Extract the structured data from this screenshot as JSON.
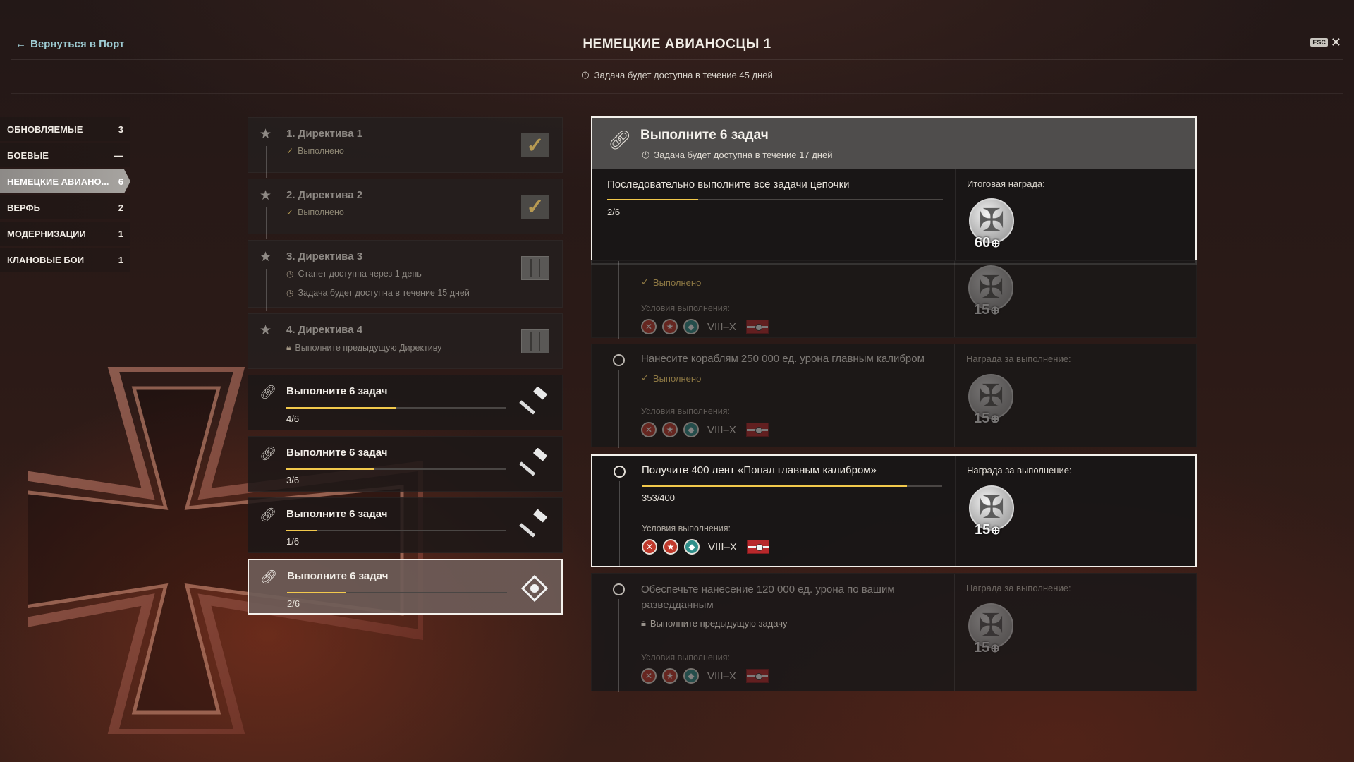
{
  "header": {
    "back_label": "Вернуться в Порт",
    "title": "НЕМЕЦКИЕ АВИАНОСЦЫ 1",
    "availability": "Задача будет доступна в течение 45 дней",
    "esc_label": "ESC",
    "close_icon": "close-icon"
  },
  "categories": [
    {
      "label": "ОБНОВЛЯЕМЫЕ",
      "count": "3",
      "active": false
    },
    {
      "label": "БОЕВЫЕ",
      "count": "—",
      "active": false
    },
    {
      "label": "НЕМЕЦКИЕ АВИАНО...",
      "count": "6",
      "active": true
    },
    {
      "label": "ВЕРФЬ",
      "count": "2",
      "active": false
    },
    {
      "label": "МОДЕРНИЗАЦИИ",
      "count": "1",
      "active": false
    },
    {
      "label": "КЛАНОВЫЕ БОИ",
      "count": "1",
      "active": false
    }
  ],
  "directives": [
    {
      "title": "1. Директива 1",
      "status": "Выполнено"
    },
    {
      "title": "2. Директива 2",
      "status": "Выполнено"
    },
    {
      "title": "3. Директива 3",
      "line1": "Станет доступна через 1 день",
      "line2": "Задача будет доступна в течение 15 дней"
    },
    {
      "title": "4. Директива 4",
      "line1": "Выполните предыдущую Директиву"
    }
  ],
  "chains": [
    {
      "title": "Выполните 6 задач",
      "progress": "4/6",
      "fraction": 0.5
    },
    {
      "title": "Выполните 6 задач",
      "progress": "3/6",
      "fraction": 0.4
    },
    {
      "title": "Выполните 6 задач",
      "progress": "1/6",
      "fraction": 0.14
    },
    {
      "title": "Выполните 6 задач",
      "progress": "2/6",
      "fraction": 0.27
    }
  ],
  "detail": {
    "title": "Выполните 6 задач",
    "availability": "Задача будет доступна в течение 17 дней",
    "description": "Последовательно выполните все задачи цепочки",
    "progress": "2/6",
    "fraction": 0.27,
    "reward_label": "Итоговая награда:",
    "reward_value": "60"
  },
  "tasks": [
    {
      "status": "Выполнено",
      "cond_label": "Условия выполнения:",
      "tier": "VIII–X",
      "reward": "15"
    },
    {
      "title": "Нанесите кораблям 250 000 ед. урона главным калибром",
      "status": "Выполнено",
      "reward_label": "Награда за выполнение:",
      "cond_label": "Условия выполнения:",
      "tier": "VIII–X",
      "reward": "15"
    },
    {
      "title": "Получите 400 лент «Попал главным калибром»",
      "progress": "353/400",
      "fraction": 0.8825,
      "reward_label": "Награда за выполнение:",
      "cond_label": "Условия выполнения:",
      "tier": "VIII–X",
      "reward": "15"
    },
    {
      "title_line1": "Обеспечьте нанесение 120 000 ед. урона по вашим",
      "title_line2": "разведданным",
      "status": "Выполните предыдущую задачу",
      "reward_label": "Награда за выполнение:",
      "cond_label": "Условия выполнения:",
      "tier": "VIII–X",
      "reward": "15"
    }
  ],
  "colors": {
    "accent": "#f2c94c",
    "done": "#a88f4f",
    "link": "#9ecbd3"
  }
}
